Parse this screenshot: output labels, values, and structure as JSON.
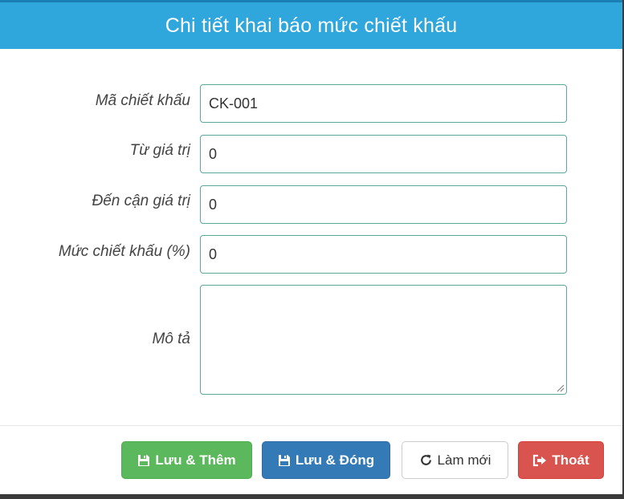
{
  "dialog": {
    "title": "Chi tiết khai báo mức chiết khấu"
  },
  "form": {
    "fields": [
      {
        "label": "Mã chiết khấu",
        "value": "CK-001"
      },
      {
        "label": "Từ giá trị",
        "value": "0"
      },
      {
        "label": "Đến cận giá trị",
        "value": "0"
      },
      {
        "label": "Mức chiết khấu (%)",
        "value": "0"
      },
      {
        "label": "Mô tả",
        "value": ""
      }
    ]
  },
  "buttons": {
    "save_add": "Lưu & Thêm",
    "save_close": "Lưu & Đóng",
    "refresh": "Làm mới",
    "exit": "Thoát"
  },
  "icons": {
    "save_add": "floppy-disk-icon",
    "save_close": "floppy-disk-icon",
    "refresh": "refresh-icon",
    "exit": "sign-out-icon"
  },
  "colors": {
    "header": "#2fa6dc",
    "save_add": "#5cb85c",
    "save_close": "#337ab7",
    "exit": "#d9534f",
    "input_border": "#5aa89a"
  }
}
